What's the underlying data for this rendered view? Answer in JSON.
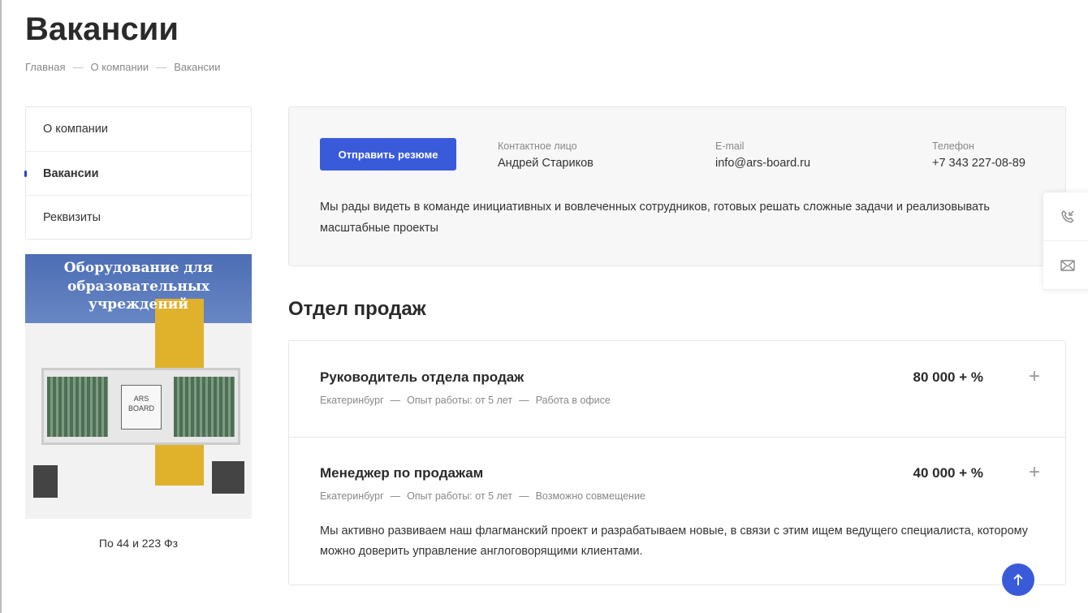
{
  "page_title": "Вакансии",
  "breadcrumbs": [
    "Главная",
    "О компании",
    "Вакансии"
  ],
  "menu": [
    {
      "label": "О компании"
    },
    {
      "label": "Вакансии"
    },
    {
      "label": "Реквизиты"
    }
  ],
  "banner": {
    "title": "Оборудование для образовательных учреждений",
    "logo": "ARS BOARD",
    "caption": "По 44 и 223 Фз"
  },
  "info": {
    "button": "Отправить резюме",
    "contact_label": "Контактное лицо",
    "contact": "Андрей Стариков",
    "email_label": "E-mail",
    "email": "info@ars-board.ru",
    "phone_label": "Телефон",
    "phone": "+7 343 227-08-89",
    "text": "Мы рады видеть в команде инициативных и вовлеченных сотрудников, готовых решать сложные задачи и реализовывать масштабные проекты"
  },
  "section_title": "Отдел продаж",
  "jobs": [
    {
      "title": "Руководитель отдела продаж",
      "salary": "80 000 + %",
      "city": "Екатеринбург",
      "experience": "Опыт работы: от 5 лет",
      "mode": "Работа в офисе"
    },
    {
      "title": "Менеджер по продажам",
      "salary": "40 000 + %",
      "city": "Екатеринбург",
      "experience": "Опыт работы: от 5 лет",
      "mode": "Возможно совмещение",
      "description": "Мы активно развиваем наш флагманский проект и разрабатываем новые, в связи с этим ищем ведущего специалиста, которому можно доверить управление англоговорящими клиентами."
    }
  ],
  "accent": "#3a5bd9"
}
